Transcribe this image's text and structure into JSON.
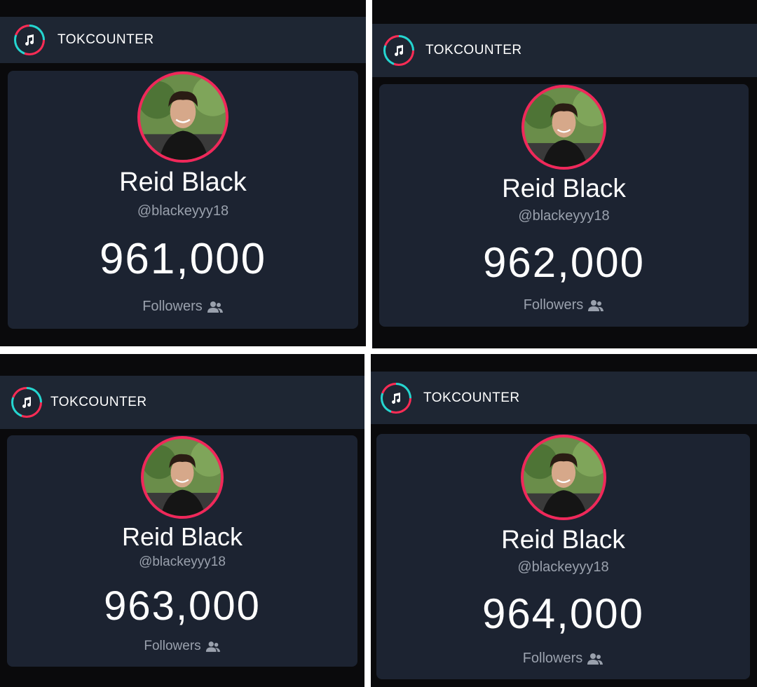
{
  "colors": {
    "header_bg": "#1e2633",
    "card_bg": "#1c2331",
    "ring": "#f0285a",
    "accent_cyan": "#25d6d0"
  },
  "panels": [
    {
      "brand": "TOKCOUNTER",
      "logo_icon": "music-note-icon",
      "name": "Reid Black",
      "handle": "@blackeyyy18",
      "count": "961,000",
      "followers_label": "Followers",
      "followers_icon": "users-icon"
    },
    {
      "brand": "TOKCOUNTER",
      "logo_icon": "music-note-icon",
      "name": "Reid Black",
      "handle": "@blackeyyy18",
      "count": "962,000",
      "followers_label": "Followers",
      "followers_icon": "users-icon"
    },
    {
      "brand": "TOKCOUNTER",
      "logo_icon": "music-note-icon",
      "name": "Reid Black",
      "handle": "@blackeyyy18",
      "count": "963,000",
      "followers_label": "Followers",
      "followers_icon": "users-icon"
    },
    {
      "brand": "TOKCOUNTER",
      "logo_icon": "music-note-icon",
      "name": "Reid Black",
      "handle": "@blackeyyy18",
      "count": "964,000",
      "followers_label": "Followers",
      "followers_icon": "users-icon"
    }
  ]
}
